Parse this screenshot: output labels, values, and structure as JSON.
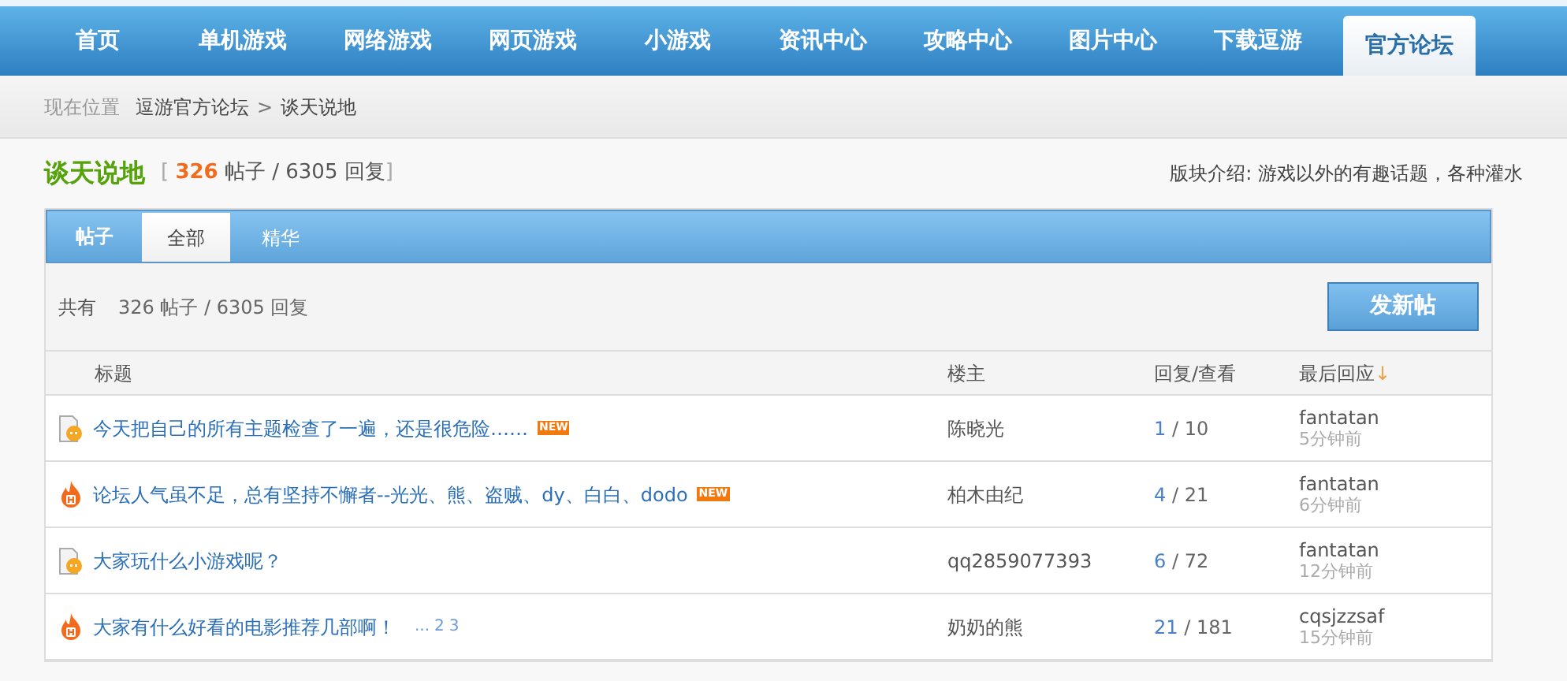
{
  "nav": [
    {
      "label": "首页",
      "selected": false
    },
    {
      "label": "单机游戏",
      "selected": false
    },
    {
      "label": "网络游戏",
      "selected": false
    },
    {
      "label": "网页游戏",
      "selected": false
    },
    {
      "label": "小游戏",
      "selected": false
    },
    {
      "label": "资讯中心",
      "selected": false
    },
    {
      "label": "攻略中心",
      "selected": false
    },
    {
      "label": "图片中心",
      "selected": false
    },
    {
      "label": "下载逗游",
      "selected": false
    },
    {
      "label": "官方论坛",
      "selected": true
    }
  ],
  "breadcrumb": {
    "label": "现在位置",
    "items": [
      "逗游官方论坛",
      "谈天说地"
    ],
    "separator": ">"
  },
  "forum": {
    "title": "谈天说地",
    "open": "[",
    "posts": "326",
    "posts_unit": "帖子 / 6305 回复",
    "close": "]",
    "intro": "版块介绍: 游戏以外的有趣话题，各种灌水"
  },
  "panel": {
    "heading": "帖子",
    "tabs": [
      {
        "label": "全部",
        "selected": true
      },
      {
        "label": "精华",
        "selected": false
      }
    ],
    "summary_label": "共有",
    "summary": "326 帖子 / 6305 回复",
    "new_post_button": "发新帖"
  },
  "table": {
    "columns": [
      "标题",
      "楼主",
      "回复/查看",
      "最后回应"
    ],
    "sort_mark": "↓",
    "count_separator": "/",
    "rows": [
      {
        "kind": "normal",
        "title": "今天把自己的所有主题检查了一遍，还是很危险……",
        "new": true,
        "new_label": "NEW",
        "pages": [],
        "author": "陈晓光",
        "replies": "1",
        "views": "10",
        "last_user": "fantatan",
        "last_time": "5分钟前"
      },
      {
        "kind": "hot",
        "title": "论坛人气虽不足，总有坚持不懈者--光光、熊、盗贼、dy、白白、dodo",
        "new": true,
        "new_label": "NEW",
        "pages": [],
        "author": "柏木由纪",
        "replies": "4",
        "views": "21",
        "last_user": "fantatan",
        "last_time": "6分钟前"
      },
      {
        "kind": "normal",
        "title": "大家玩什么小游戏呢？",
        "new": false,
        "pages": [],
        "author": "qq2859077393",
        "replies": "6",
        "views": "72",
        "last_user": "fantatan",
        "last_time": "12分钟前"
      },
      {
        "kind": "hot",
        "title": "大家有什么好看的电影推荐几部啊！",
        "new": false,
        "pages_prefix": "...",
        "pages": [
          "2",
          "3"
        ],
        "author": "奶奶的熊",
        "replies": "21",
        "views": "181",
        "last_user": "cqsjzzsaf",
        "last_time": "15分钟前"
      }
    ]
  }
}
